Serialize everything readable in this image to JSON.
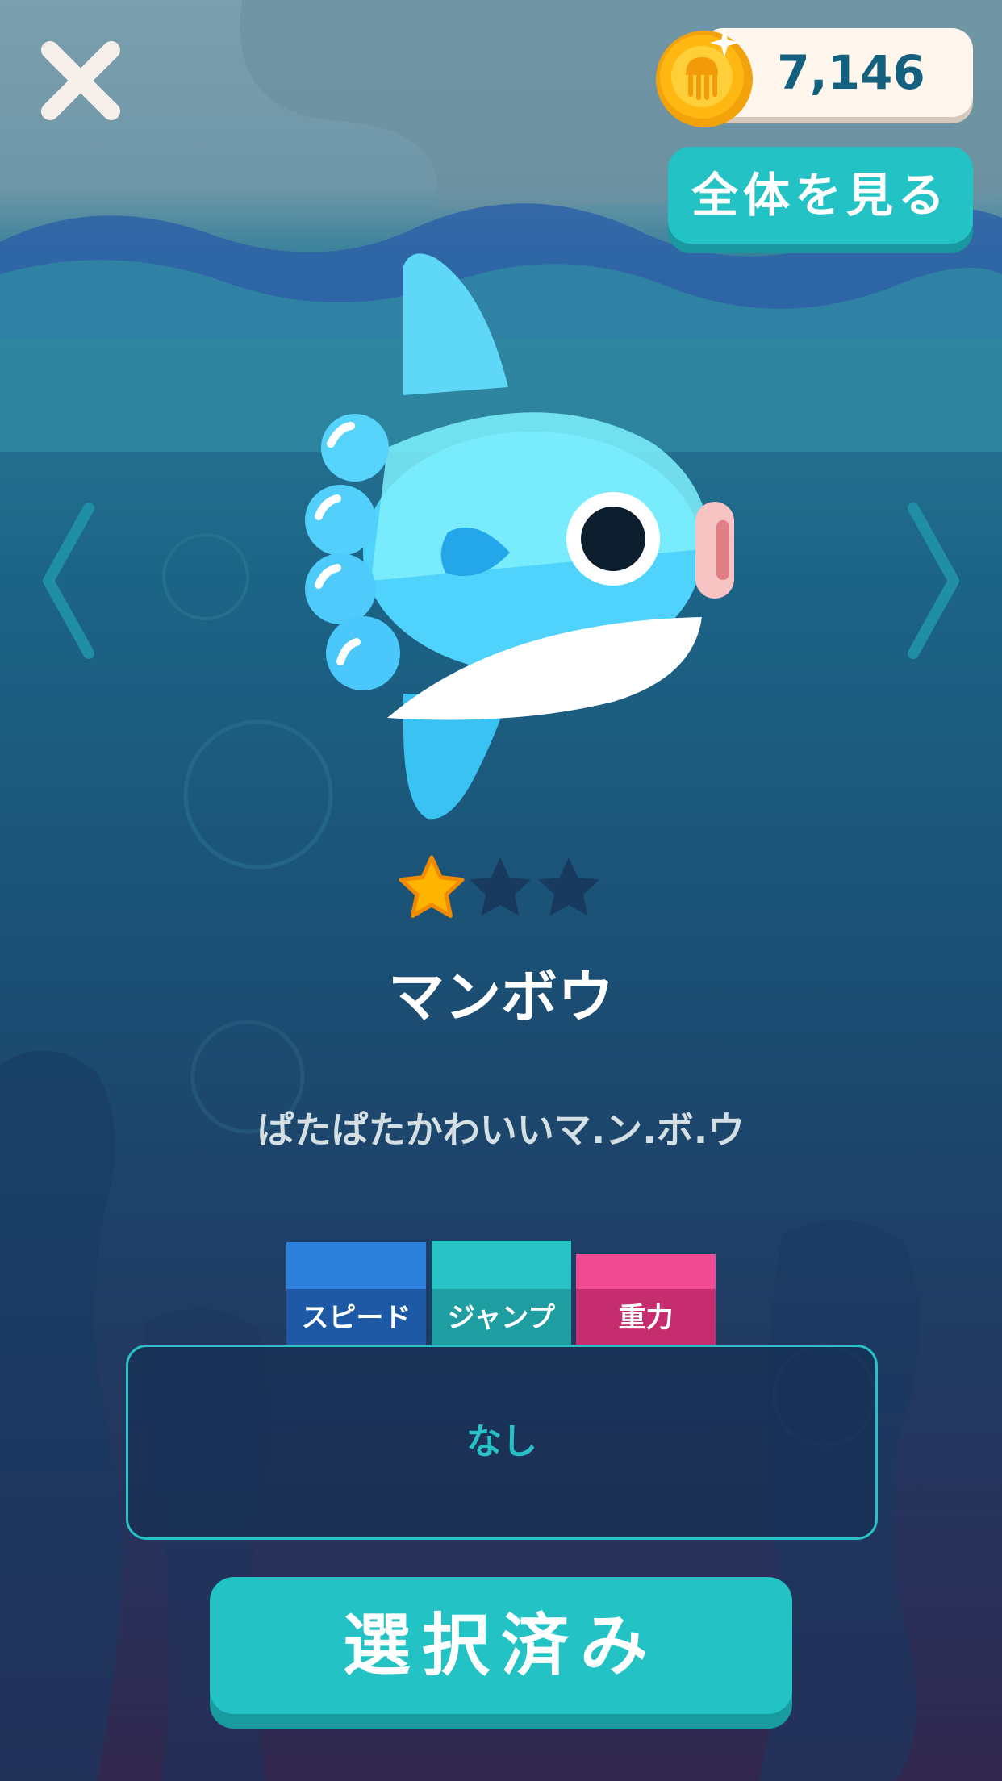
{
  "header": {
    "close_icon": "close-x-icon",
    "coins": "7,146",
    "coin_icon": "jellyfish-coin-icon",
    "view_all_label": "全体を見る"
  },
  "navigation": {
    "prev_icon": "chevron-left-icon",
    "next_icon": "chevron-right-icon"
  },
  "character": {
    "name": "マンボウ",
    "description": "ぱたぱたかわいいマ.ン.ボ.ウ",
    "rating": 1,
    "rating_max": 3,
    "image": "sunfish-character"
  },
  "stats": {
    "speed_label": "スピード",
    "jump_label": "ジャンプ",
    "gravity_label": "重力"
  },
  "ability": {
    "text": "なし"
  },
  "actions": {
    "select_label": "選択済み"
  },
  "colors": {
    "accent_teal": "#22c2c5",
    "speed_blue": "#2d7fdc",
    "gravity_pink": "#f04a93",
    "star_gold": "#ffb400"
  }
}
